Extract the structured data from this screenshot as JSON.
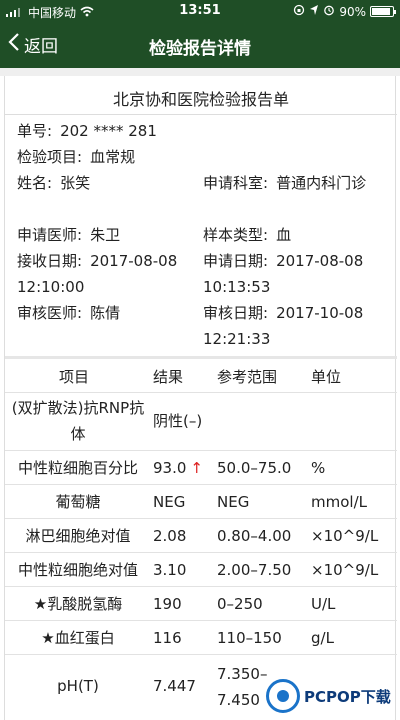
{
  "status_bar": {
    "carrier": "中国移动",
    "time": "13:51",
    "battery": "90%",
    "battery_level": 0.9
  },
  "nav": {
    "back_label": "返回",
    "title": "检验报告详情"
  },
  "report": {
    "title": "北京协和医院检验报告单",
    "fields": {
      "order_no": {
        "label": "单号:",
        "value": "202 **** 281"
      },
      "test_item": {
        "label": "检验项目:",
        "value": "血常规"
      },
      "name": {
        "label": "姓名:",
        "value": "张笑"
      },
      "dept": {
        "label": "申请科室:",
        "value": "普通内科门诊"
      },
      "doctor": {
        "label": "申请医师:",
        "value": "朱卫"
      },
      "sample_type": {
        "label": "样本类型:",
        "value": "血"
      },
      "receive_date": {
        "label": "接收日期:",
        "value": "2017-08-08 12:10:00"
      },
      "apply_date": {
        "label": "申请日期:",
        "value": "2017-08-08 10:13:53"
      },
      "reviewer": {
        "label": "审核医师:",
        "value": "陈倩"
      },
      "review_date": {
        "label": "审核日期:",
        "value": "2017-10-08 12:21:33"
      }
    }
  },
  "table": {
    "headers": [
      "项目",
      "结果",
      "参考范围",
      "单位"
    ],
    "rows": [
      {
        "item": "(双扩散法)抗RNP抗体",
        "result": "阴性(–)",
        "range": "",
        "unit": ""
      },
      {
        "item": "中性粒细胞百分比",
        "result": "93.0",
        "flag": "↑",
        "range": "50.0–75.0",
        "unit": "%"
      },
      {
        "item": "葡萄糖",
        "result": "NEG",
        "range": "NEG",
        "unit": "mmol/L"
      },
      {
        "item": "淋巴细胞绝对值",
        "result": "2.08",
        "range": "0.80–4.00",
        "unit": "×10^9/L"
      },
      {
        "item": "中性粒细胞绝对值",
        "result": "3.10",
        "range": "2.00–7.50",
        "unit": "×10^9/L"
      },
      {
        "item": "★乳酸脱氢酶",
        "result": "190",
        "range": "0–250",
        "unit": "U/L"
      },
      {
        "item": "★血红蛋白",
        "result": "116",
        "range": "110–150",
        "unit": "g/L"
      },
      {
        "item": "pH(T)",
        "result": "7.447",
        "range": "7.350–7.450",
        "unit": ""
      }
    ]
  },
  "watermark": {
    "text": "PCPOP下载"
  },
  "colors": {
    "header_bg": "#1f4e26",
    "alert": "#d22222"
  }
}
